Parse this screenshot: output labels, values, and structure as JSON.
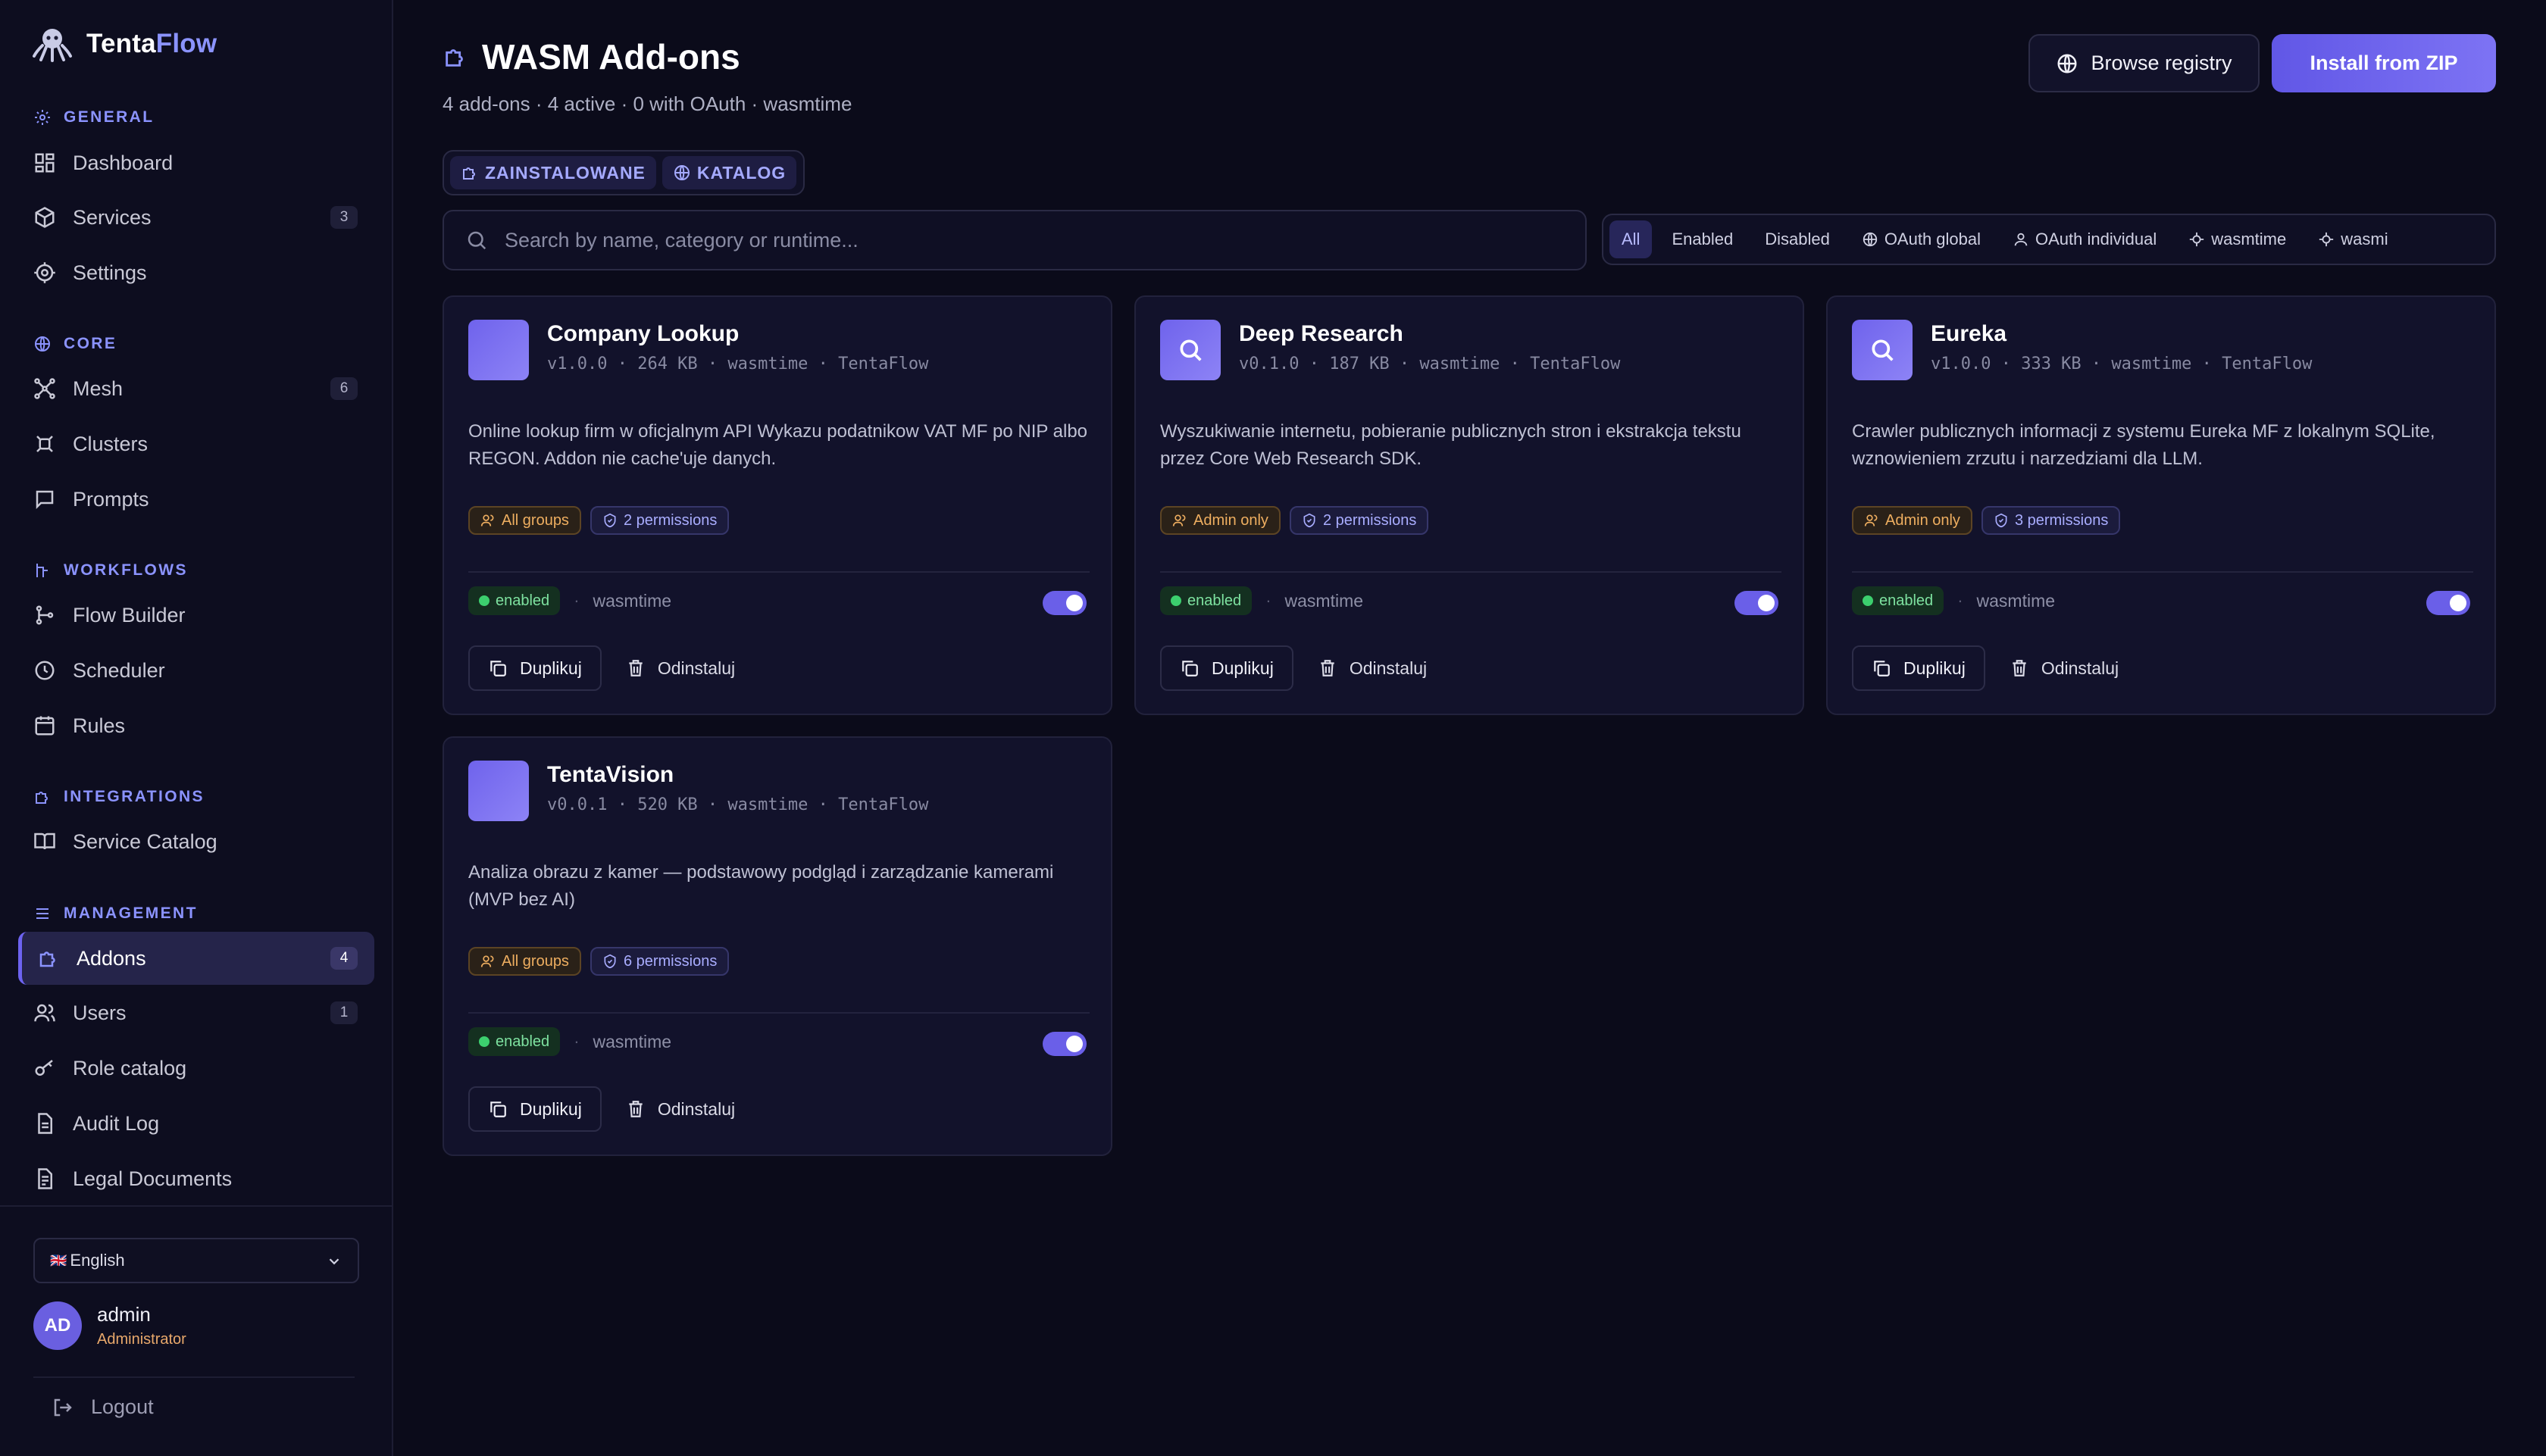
{
  "brand": {
    "name_part1": "Tenta",
    "name_part2": "Flow"
  },
  "sidebar": {
    "sections": [
      {
        "label": "GENERAL",
        "items": [
          {
            "label": "Dashboard",
            "badge": null
          },
          {
            "label": "Services",
            "badge": "3"
          },
          {
            "label": "Settings",
            "badge": null
          }
        ]
      },
      {
        "label": "CORE",
        "items": [
          {
            "label": "Mesh",
            "badge": "6"
          },
          {
            "label": "Clusters",
            "badge": null
          },
          {
            "label": "Prompts",
            "badge": null
          }
        ]
      },
      {
        "label": "WORKFLOWS",
        "items": [
          {
            "label": "Flow Builder",
            "badge": null
          },
          {
            "label": "Scheduler",
            "badge": null
          },
          {
            "label": "Rules",
            "badge": null
          }
        ]
      },
      {
        "label": "INTEGRATIONS",
        "items": [
          {
            "label": "Service Catalog",
            "badge": null
          }
        ]
      },
      {
        "label": "MANAGEMENT",
        "items": [
          {
            "label": "Addons",
            "badge": "4",
            "active": true
          },
          {
            "label": "Users",
            "badge": "1"
          },
          {
            "label": "Role catalog",
            "badge": null
          },
          {
            "label": "Audit Log",
            "badge": null
          },
          {
            "label": "Legal Documents",
            "badge": null
          }
        ]
      }
    ],
    "language": {
      "flag": "🇬🇧",
      "label": "English"
    },
    "user": {
      "initials": "AD",
      "name": "admin",
      "role": "Administrator"
    },
    "logout_label": "Logout"
  },
  "header": {
    "title": "WASM Add-ons",
    "subtitle": "4 add-ons · 4 active · 0 with OAuth · wasmtime",
    "browse_label": "Browse registry",
    "install_label": "Install from ZIP"
  },
  "tabs": [
    {
      "label": "ZAINSTALOWANE"
    },
    {
      "label": "KATALOG"
    }
  ],
  "search": {
    "placeholder": "Search by name, category or runtime...",
    "value": ""
  },
  "filters": [
    {
      "label": "All",
      "active": true
    },
    {
      "label": "Enabled"
    },
    {
      "label": "Disabled"
    },
    {
      "label": "OAuth global",
      "icon": "globe-icon"
    },
    {
      "label": "OAuth individual",
      "icon": "user-icon"
    },
    {
      "label": "wasmtime",
      "icon": "chip-icon"
    },
    {
      "label": "wasmi",
      "icon": "chip-icon"
    }
  ],
  "addons": [
    {
      "name": "Company Lookup",
      "meta": "v1.0.0 · 264 KB · wasmtime · TentaFlow",
      "icon": "none",
      "description": "Online lookup firm w oficjalnym API Wykazu podatnikow VAT MF po NIP albo REGON. Addon nie cache'uje danych.",
      "access": "All groups",
      "permissions": "2 permissions",
      "status": "enabled",
      "runtime": "wasmtime",
      "enabled": true,
      "duplicate_label": "Duplikuj",
      "uninstall_label": "Odinstaluj"
    },
    {
      "name": "Deep Research",
      "meta": "v0.1.0 · 187 KB · wasmtime · TentaFlow",
      "icon": "search-icon",
      "description": "Wyszukiwanie internetu, pobieranie publicznych stron i ekstrakcja tekstu przez Core Web Research SDK.",
      "access": "Admin only",
      "permissions": "2 permissions",
      "status": "enabled",
      "runtime": "wasmtime",
      "enabled": true,
      "duplicate_label": "Duplikuj",
      "uninstall_label": "Odinstaluj"
    },
    {
      "name": "Eureka",
      "meta": "v1.0.0 · 333 KB · wasmtime · TentaFlow",
      "icon": "search-icon",
      "description": "Crawler publicznych informacji z systemu Eureka MF z lokalnym SQLite, wznowieniem zrzutu i narzedziami dla LLM.",
      "access": "Admin only",
      "permissions": "3 permissions",
      "status": "enabled",
      "runtime": "wasmtime",
      "enabled": true,
      "duplicate_label": "Duplikuj",
      "uninstall_label": "Odinstaluj"
    },
    {
      "name": "TentaVision",
      "meta": "v0.0.1 · 520 KB · wasmtime · TentaFlow",
      "icon": "none",
      "description": "Analiza obrazu z kamer — podstawowy podgląd i zarządzanie kamerami (MVP bez AI)",
      "access": "All groups",
      "permissions": "6 permissions",
      "status": "enabled",
      "runtime": "wasmtime",
      "enabled": true,
      "duplicate_label": "Duplikuj",
      "uninstall_label": "Odinstaluj"
    }
  ],
  "colors": {
    "accent": "#6d63f0",
    "accent_text": "#8b93ff",
    "background": "#0b0b1a",
    "card": "#12122b",
    "enabled_green": "#3ccf6e",
    "warning_orange": "#eeae60"
  }
}
